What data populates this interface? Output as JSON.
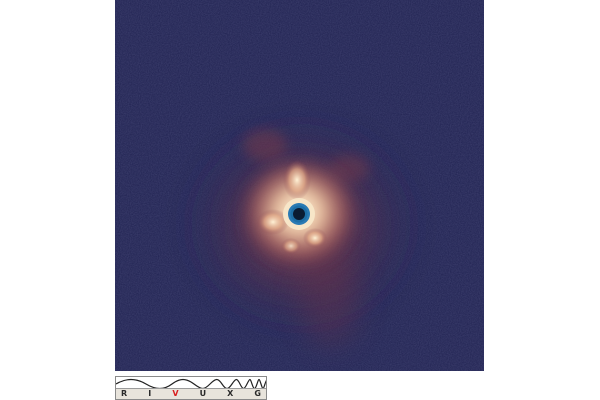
{
  "image": {
    "subject": "point-source",
    "colors": {
      "background": "#1f2150",
      "glow_outer": "#7a3b43",
      "glow_mid": "#c98973",
      "glow_core": "#fdf3da",
      "ring": "#1d6fa6",
      "ring_center": "#0a1c33"
    }
  },
  "spectrum_strip": {
    "bands": [
      "R",
      "I",
      "V",
      "U",
      "X",
      "G"
    ],
    "highlighted_band": "V",
    "highlight_color": "#d81e1e"
  }
}
